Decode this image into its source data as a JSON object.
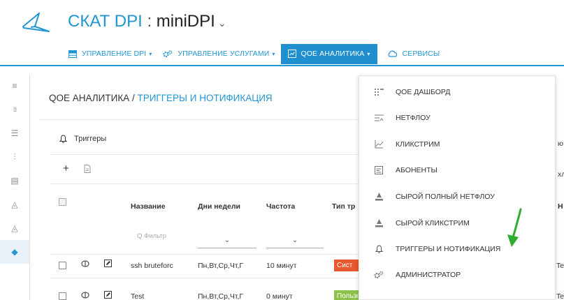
{
  "app": {
    "brand": "СКАТ DPI",
    "separator": " : ",
    "device": "miniDPI",
    "device_chevron": "⌄"
  },
  "topnav": {
    "items": [
      {
        "label": "УПРАВЛЕНИЕ DPI",
        "caret": "▾",
        "icon": "table-icon"
      },
      {
        "label": "УПРАВЛЕНИЕ УСЛУГАМИ",
        "caret": "▾",
        "icon": "gears-icon"
      },
      {
        "label": "QOE АНАЛИТИКА",
        "caret": "▾",
        "icon": "chart-box-icon"
      },
      {
        "label": "СЕРВИСЫ",
        "caret": "",
        "icon": "cloud-icon"
      }
    ],
    "active_color": "#1f8fd0",
    "accent": "#2196d3"
  },
  "breadcrumb": {
    "root": "QOE АНАЛИТИКА / ",
    "current": "ТРИГГЕРЫ И НОТИФИКАЦИЯ"
  },
  "triggers": {
    "header": "Триггеры",
    "add": "+",
    "table": {
      "columns": [
        "Название",
        "Дни недели",
        "Частота",
        "Тип тр"
      ],
      "filter_placeholder": "Q Фильтр",
      "select_chevron": "⌄",
      "rows": [
        {
          "name": "ssh bruteforc",
          "days": "Пн,Вт,Ср,Чт,Г",
          "freq": "10 минут",
          "type": "Сист",
          "type_color": "#e8572e",
          "right": "Te"
        },
        {
          "name": "Test",
          "days": "Пн,Вт,Ср,Чт,Г",
          "freq": "0 минут",
          "type": "Пользовательский",
          "type_color": "#8bc34a",
          "right": "Te"
        }
      ]
    },
    "right_peek": {
      "h": "Н",
      "a": "хл",
      "c": "ю"
    }
  },
  "dropdown": {
    "items": [
      {
        "label": "QOE ДАШБОРД",
        "icon": "dashboard-grid-icon"
      },
      {
        "label": "НЕТФЛОУ",
        "icon": "netflow-icon"
      },
      {
        "label": "КЛИКСТРИМ",
        "icon": "clickstream-icon"
      },
      {
        "label": "АБОНЕНТЫ",
        "icon": "subscribers-icon"
      },
      {
        "label": "СЫРОЙ ПОЛНЫЙ НЕТФЛОУ",
        "icon": "raw-netflow-icon"
      },
      {
        "label": "СЫРОЙ КЛИКСТРИМ",
        "icon": "raw-clickstream-icon"
      },
      {
        "label": "ТРИГГЕРЫ И НОТИФИКАЦИЯ",
        "icon": "bell-icon"
      },
      {
        "label": "АДМИНИСТРАТОР",
        "icon": "admin-gears-icon"
      }
    ]
  },
  "annotation_arrow_color": "#2eae2e"
}
